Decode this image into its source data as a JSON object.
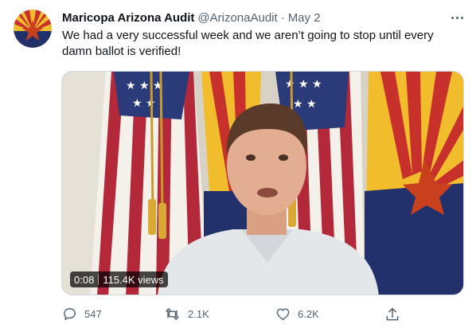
{
  "account": {
    "display_name": "Maricopa Arizona Audit",
    "handle": "@ArizonaAudit",
    "separator": "·",
    "date": "May 2",
    "avatar_icon": "arizona-flag-star-avatar"
  },
  "tweet": {
    "text": "We had a very successful week and we aren’t going to stop until every damn ballot is verified!"
  },
  "video": {
    "duration": "0:08",
    "views": "115.4K views"
  },
  "actions": {
    "reply_count": "547",
    "retweet_count": "2.1K",
    "like_count": "6.2K"
  },
  "colors": {
    "text_primary": "#0f1419",
    "text_secondary": "#536471",
    "az_copper": "#c9411c",
    "az_blue": "#22306b",
    "az_gold": "#f2bd2c",
    "az_red": "#c8302b"
  },
  "icons": [
    "more-icon",
    "reply-icon",
    "retweet-icon",
    "like-icon",
    "share-icon"
  ]
}
